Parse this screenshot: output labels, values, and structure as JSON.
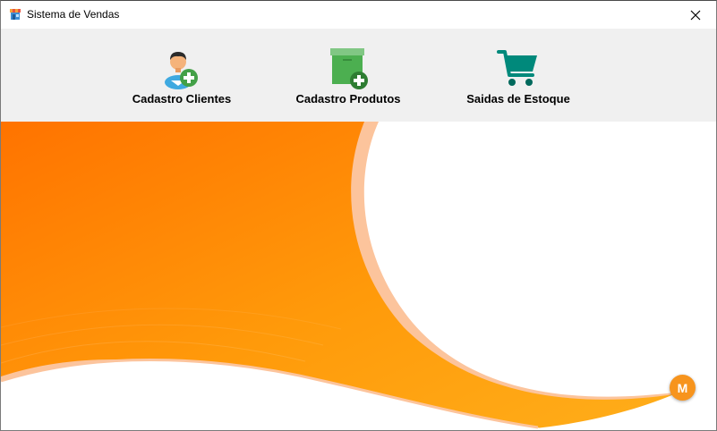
{
  "window": {
    "title": "Sistema de Vendas",
    "icon": "store-icon",
    "close_icon": "close-icon"
  },
  "toolbar": {
    "items": [
      {
        "label": "Cadastro Clientes",
        "icon": "add-user-icon"
      },
      {
        "label": "Cadastro Produtos",
        "icon": "add-product-box-icon"
      },
      {
        "label": "Saidas de Estoque",
        "icon": "shopping-cart-icon"
      }
    ]
  },
  "banner": {
    "colors": {
      "primary": "#ff7a00",
      "secondary": "#ffa514",
      "accent_light": "#fcc49c"
    }
  },
  "badge": {
    "text": "M",
    "color": "#f7941d"
  }
}
